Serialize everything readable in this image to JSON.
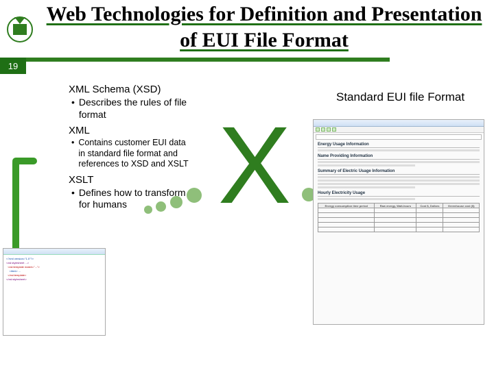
{
  "slide": {
    "number": "19",
    "title": "Web Technologies for Definition and Presentation of EUI File Format"
  },
  "left": {
    "xsd_head": "XML Schema (XSD)",
    "xsd_bullet": "Describes the rules of file format",
    "xml_head": "XML",
    "xml_bullet": "Contains customer EUI data in standard file format and references to XSD and XSLT",
    "xslt_head": "XSLT",
    "xslt_bullet": "Defines how to transform for humans"
  },
  "center": {
    "glyph": "X"
  },
  "right": {
    "heading": "Standard EUI file Format",
    "mock": {
      "s1": "Energy Usage Information",
      "s2": "Name Providing Information",
      "s3": "Summary of Electric Usage Information",
      "s4": "Hourly Electricity Usage",
      "th1": "Energy consumption time period",
      "th2": "Raw energy, Watt-hours",
      "th3": "Cost $, Dollars",
      "th4": "Greenhouse cost ($)"
    }
  },
  "code": {
    "l1": "<?xml version=\"1.0\"?>",
    "l2": "<xsl:stylesheet ...>",
    "l3": "  <xsl:template match=\"...\">",
    "l4": "    <html> ...",
    "l5": "  </xsl:template>",
    "l6": "</xsl:stylesheet>"
  }
}
